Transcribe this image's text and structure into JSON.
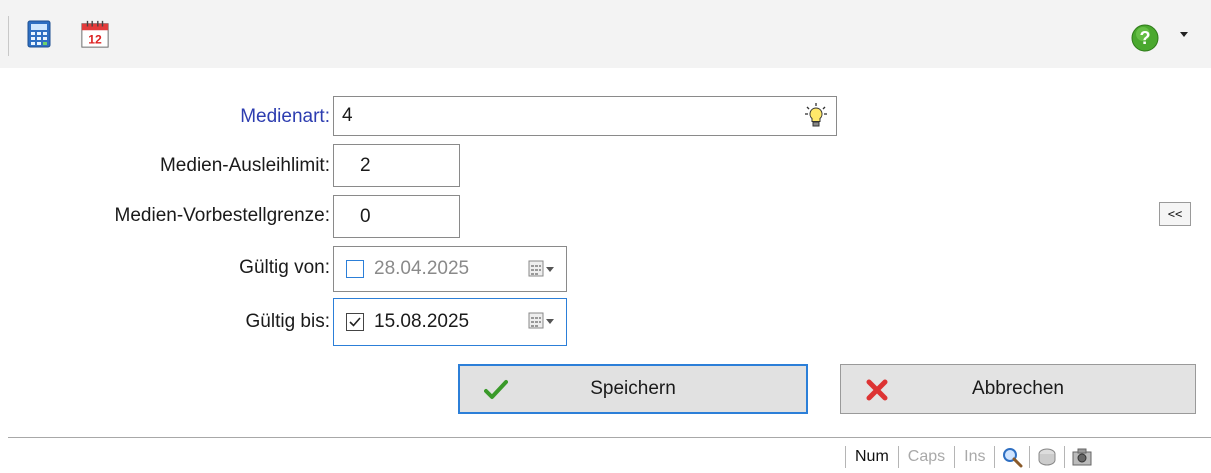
{
  "toolbar": {
    "icons": [
      "calculator-icon",
      "calendar-icon"
    ],
    "calendar_day": "12",
    "help_icon": "help-icon"
  },
  "form": {
    "medienart": {
      "label": "Medienart:",
      "value": "4"
    },
    "ausleihlimit": {
      "label": "Medien-Ausleihlimit:",
      "value": "2"
    },
    "vorbestellgrenze": {
      "label": "Medien-Vorbestellgrenze:",
      "value": "0"
    },
    "gueltig_von": {
      "label": "Gültig von:",
      "value": "28.04.2025",
      "checked": false
    },
    "gueltig_bis": {
      "label": "Gültig bis:",
      "value": "15.08.2025",
      "checked": true
    }
  },
  "collapse_label": "<<",
  "buttons": {
    "save": "Speichern",
    "cancel": "Abbrechen"
  },
  "statusbar": {
    "num": "Num",
    "caps": "Caps",
    "ins": "Ins"
  },
  "colors": {
    "label_link": "#2d3db0",
    "focus": "#2c7fd8",
    "save_check": "#3a9a2a",
    "cancel_x": "#d33"
  }
}
